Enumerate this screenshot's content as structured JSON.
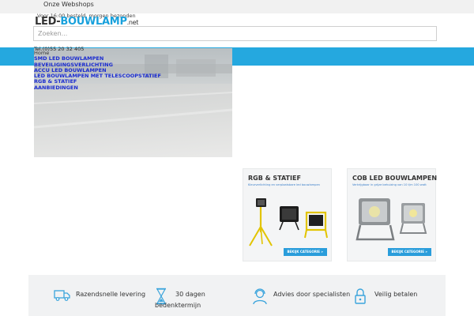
{
  "topbar": {
    "webshops_label": "Onze Webshops"
  },
  "tagline": "Voor 16:00 besteld, morgen bezonden",
  "logo": {
    "part1": "LED-",
    "part2": "BOUWLAMP",
    "part3": ".net"
  },
  "search": {
    "placeholder": "Zoeken...",
    "value": ""
  },
  "phone": "Tel.(0)55 20 32 405",
  "menu": {
    "items": [
      "Home",
      "SMD LED bouwlampen",
      "Beveiligingsverlichting",
      "Accu LED bouwlampen",
      "LED bouwlampen met telescoopstatief",
      "RGB & Statief",
      "Aanbiedingen"
    ]
  },
  "categories": [
    {
      "title": "RGB & STATIEF",
      "subtitle": "Kleurverlichting en verplaatsbare led bouwlampen",
      "button": "BEKIJK CATEGORIE »"
    },
    {
      "title": "COB LED BOUWLAMPEN",
      "subtitle": "Verkrijgbaar in grijze behuizing van 10 t/m 100 watt",
      "button": "BEKIJK CATEGORIE »"
    }
  ],
  "usps": [
    {
      "icon": "truck-icon",
      "label": "Razendsnelle levering"
    },
    {
      "icon": "hourglass-icon",
      "label_line1": "30 dagen",
      "label_line2": "bedenktermijn"
    },
    {
      "icon": "support-agent-icon",
      "label": "Advies door specialisten"
    },
    {
      "icon": "lock-icon",
      "label": "Veilig betalen"
    }
  ],
  "colors": {
    "accent": "#25a8df",
    "menu_link": "#1a2bd0",
    "button": "#2a9ddb"
  }
}
